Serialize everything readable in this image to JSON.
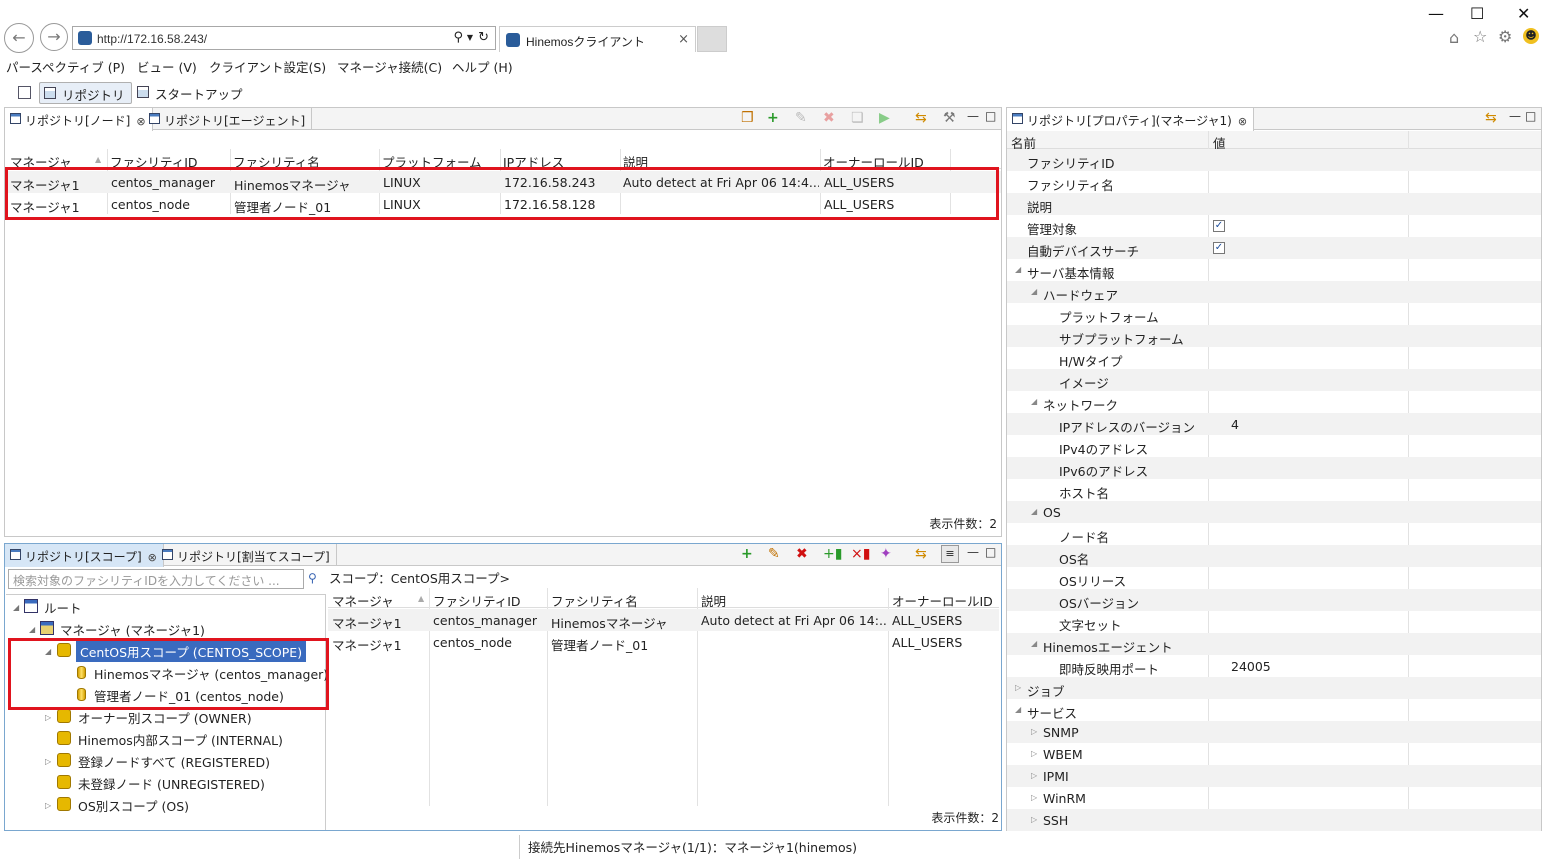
{
  "browser": {
    "address": "http://172.16.58.243/",
    "tab_title": "Hinemosクライアント",
    "tab_close": "×",
    "minimize": "—",
    "maximize": "☐",
    "close": "✕"
  },
  "menu": [
    "パースペクティブ (P)",
    "ビュー (V)",
    "クライアント設定(S)",
    "マネージャ接続(C)",
    "ヘルプ (H)"
  ],
  "perspectives": {
    "repository": "リポジトリ",
    "startup": "スタートアップ"
  },
  "node_view": {
    "tab_active": "リポジトリ[ノード]",
    "tab_other": "リポジトリ[エージェント]",
    "columns": [
      "マネージャ",
      "ファシリティID",
      "ファシリティ名",
      "プラットフォーム",
      "IPアドレス",
      "説明",
      "オーナーロールID"
    ],
    "rows": [
      [
        "マネージャ1",
        "centos_manager",
        "Hinemosマネージャ",
        "LINUX",
        "172.16.58.243",
        "Auto detect at Fri Apr 06 14:4...",
        "ALL_USERS"
      ],
      [
        "マネージャ1",
        "centos_node",
        "管理者ノード_01",
        "LINUX",
        "172.16.58.128",
        "",
        "ALL_USERS"
      ]
    ],
    "count": "表示件数：2"
  },
  "scope_view": {
    "tab_active": "リポジトリ[スコープ]",
    "tab_other": "リポジトリ[割当てスコープ]",
    "search_placeholder": "検索対象のファシリティIDを入力してください ...",
    "scope_path": "スコープ：CentOS用スコープ>",
    "tree": {
      "root": "ルート",
      "manager": "マネージャ (マネージャ1)",
      "centos_scope": "CentOS用スコープ (CENTOS_SCOPE)",
      "node1": "Hinemosマネージャ (centos_manager)",
      "node2": "管理者ノード_01 (centos_node)",
      "owner": "オーナー別スコープ (OWNER)",
      "internal": "Hinemos内部スコープ (INTERNAL)",
      "registered": "登録ノードすべて (REGISTERED)",
      "unregistered": "未登録ノード (UNREGISTERED)",
      "os": "OS別スコープ (OS)"
    },
    "columns": [
      "マネージャ",
      "ファシリティID",
      "ファシリティ名",
      "説明",
      "オーナーロールID"
    ],
    "rows": [
      [
        "マネージャ1",
        "centos_manager",
        "Hinemosマネージャ",
        "Auto detect at Fri Apr 06 14:...",
        "ALL_USERS"
      ],
      [
        "マネージャ1",
        "centos_node",
        "管理者ノード_01",
        "",
        "ALL_USERS"
      ]
    ],
    "count": "表示件数：2"
  },
  "prop_view": {
    "tab": "リポジトリ[プロパティ](マネージャ1)",
    "col_name": "名前",
    "col_value": "値",
    "items": {
      "facility_id": "ファシリティID",
      "facility_name": "ファシリティ名",
      "description": "説明",
      "managed": "管理対象",
      "auto_device": "自動デバイスサーチ",
      "server_basic": "サーバ基本情報",
      "hardware": "ハードウェア",
      "platform": "プラットフォーム",
      "sub_platform": "サブプラットフォーム",
      "hw_type": "H/Wタイプ",
      "image": "イメージ",
      "network": "ネットワーク",
      "ip_version": "IPアドレスのバージョン",
      "ip_version_val": "4",
      "ipv4": "IPv4のアドレス",
      "ipv6": "IPv6のアドレス",
      "hostname": "ホスト名",
      "os": "OS",
      "node_name": "ノード名",
      "os_name": "OS名",
      "os_release": "OSリリース",
      "os_version": "OSバージョン",
      "charset": "文字セット",
      "agent": "Hinemosエージェント",
      "port": "即時反映用ポート",
      "port_val": "24005",
      "job": "ジョブ",
      "service": "サービス",
      "snmp": "SNMP",
      "wbem": "WBEM",
      "ipmi": "IPMI",
      "winrm": "WinRM",
      "ssh": "SSH"
    }
  },
  "status": "接続先Hinemosマネージャ(1/1)：マネージャ1(hinemos)"
}
